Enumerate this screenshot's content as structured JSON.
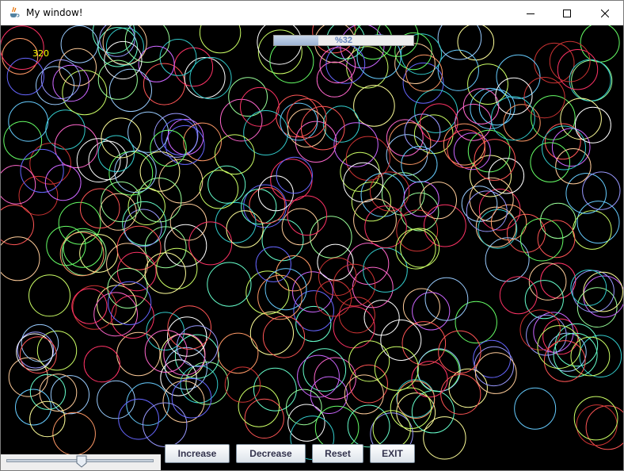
{
  "window": {
    "title": "My window!",
    "icon": "java-coffee-cup-icon",
    "controls": [
      "minimize-icon",
      "maximize-icon",
      "close-icon"
    ]
  },
  "counter": {
    "value": "320",
    "color": "#ffff00"
  },
  "progress": {
    "text": "%32",
    "value": 0.32
  },
  "buttons": {
    "increase": "Increase",
    "decrease": "Decrease",
    "reset": "Reset",
    "exit": "EXIT"
  },
  "slider": {
    "value": 0.51
  },
  "circles": {
    "count": 320,
    "background": "#000000"
  }
}
